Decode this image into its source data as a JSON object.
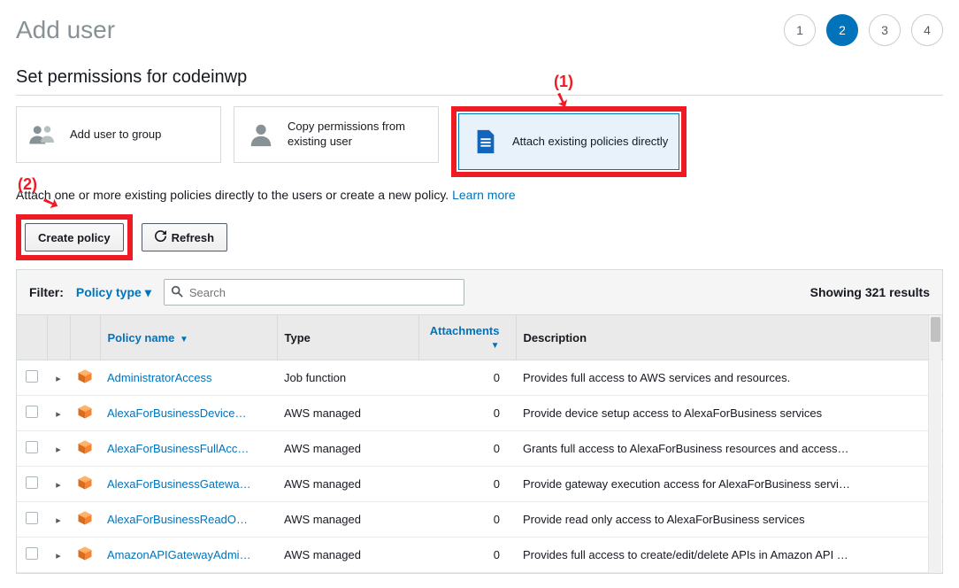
{
  "header": {
    "title": "Add user",
    "steps": [
      "1",
      "2",
      "3",
      "4"
    ],
    "active_step_index": 1
  },
  "section": {
    "title": "Set permissions for codeinwp"
  },
  "perm_options": {
    "add_to_group": "Add user to group",
    "copy_from_existing": "Copy permissions from existing user",
    "attach_directly": "Attach existing policies directly"
  },
  "helper": {
    "text": "Attach one or more existing policies directly to the users or create a new policy. ",
    "link": "Learn more"
  },
  "buttons": {
    "create_policy": "Create policy",
    "refresh": "Refresh"
  },
  "annotations": {
    "one": "(1)",
    "two": "(2)"
  },
  "filter": {
    "label": "Filter:",
    "type": "Policy type",
    "search_placeholder": "Search",
    "results_text": "Showing 321 results"
  },
  "columns": {
    "policy_name": "Policy name",
    "type": "Type",
    "attachments": "Attachments",
    "description": "Description"
  },
  "policies": [
    {
      "name": "AdministratorAccess",
      "type": "Job function",
      "attachments": "0",
      "description": "Provides full access to AWS services and resources."
    },
    {
      "name": "AlexaForBusinessDevice…",
      "type": "AWS managed",
      "attachments": "0",
      "description": "Provide device setup access to AlexaForBusiness services"
    },
    {
      "name": "AlexaForBusinessFullAcc…",
      "type": "AWS managed",
      "attachments": "0",
      "description": "Grants full access to AlexaForBusiness resources and access…"
    },
    {
      "name": "AlexaForBusinessGatewa…",
      "type": "AWS managed",
      "attachments": "0",
      "description": "Provide gateway execution access for AlexaForBusiness servi…"
    },
    {
      "name": "AlexaForBusinessReadO…",
      "type": "AWS managed",
      "attachments": "0",
      "description": "Provide read only access to AlexaForBusiness services"
    },
    {
      "name": "AmazonAPIGatewayAdmi…",
      "type": "AWS managed",
      "attachments": "0",
      "description": "Provides full access to create/edit/delete APIs in Amazon API …"
    }
  ]
}
